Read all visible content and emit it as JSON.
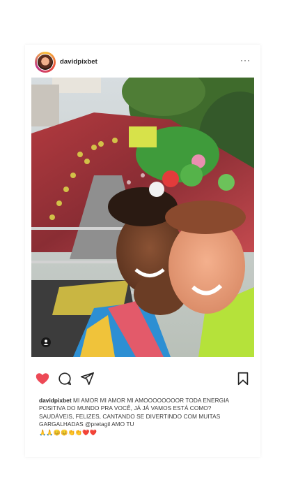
{
  "post": {
    "username": "davidpixbet",
    "more_label": "···",
    "caption": {
      "username": "davidpixbet",
      "text_part1": "MI AMOR MI AMOR MI AMOOOOOOOOR TODA ENERGIA POSITIVA DO MUNDO PRA VOCÊ, JÁ JÁ VAMOS ESTÁ COMO? SAUDÁVEIS, FELIZES, CANTANDO SE DIVERTINDO COM MUITAS GARGALHADAS",
      "mention": "@pretagil",
      "text_part2": "AMO TU",
      "emojis": "🙏🙏😊😊👏👏❤️❤️"
    }
  },
  "icons": {
    "like": "heart-icon",
    "comment": "comment-icon",
    "share": "send-icon",
    "save": "bookmark-icon",
    "tag": "user-tag-icon"
  },
  "colors": {
    "like_red": "#ed4956",
    "text": "#262626"
  }
}
